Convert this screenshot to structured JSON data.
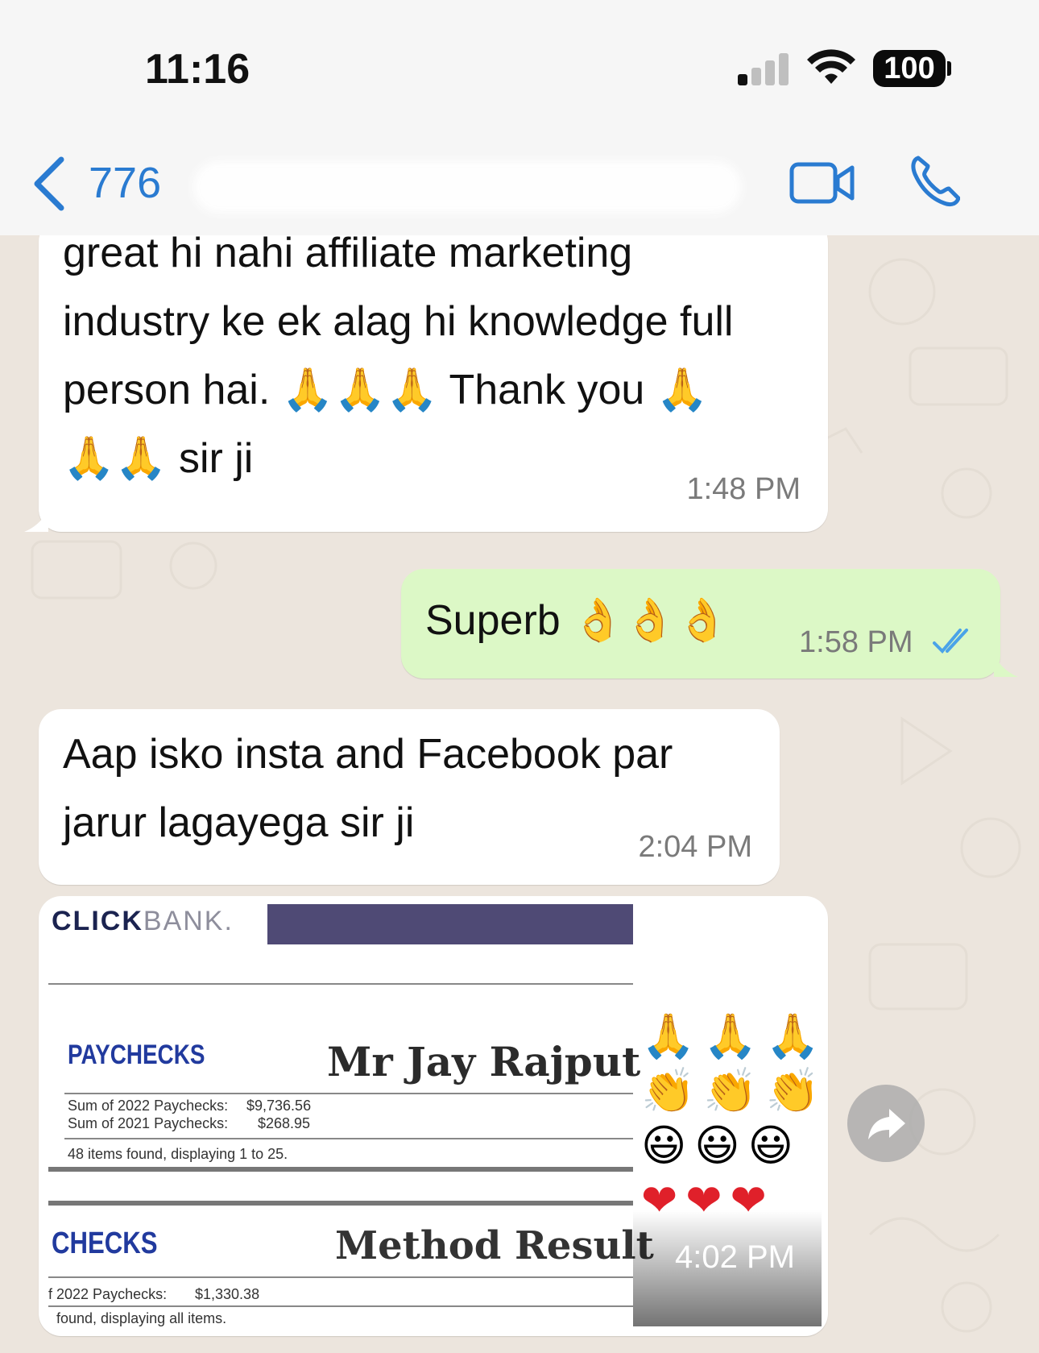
{
  "status_bar": {
    "time": "11:16",
    "battery": "100"
  },
  "header": {
    "back_label": "776"
  },
  "messages": [
    {
      "direction": "in",
      "lines": [
        "great hi nahi affiliate marketing",
        "industry ke ek alag hi knowledge full",
        "person hai. 🙏🙏🙏 Thank you 🙏",
        "🙏🙏 sir ji"
      ],
      "time": "1:48 PM"
    },
    {
      "direction": "out",
      "text": "Superb 👌👌👌",
      "time": "1:58 PM",
      "status": "read"
    },
    {
      "direction": "in",
      "lines": [
        "Aap isko insta and Facebook par",
        "jarur lagayega sir ji"
      ],
      "time": "2:04 PM"
    },
    {
      "direction": "in",
      "type": "image",
      "time": "4:02 PM",
      "image": {
        "logo_part1": "CLICK",
        "logo_part2": "BANK.",
        "paychecks_title": "PAYCHECKS",
        "name": "Mr Jay Rajput",
        "sum_2022_label": "Sum of 2022 Paychecks:",
        "sum_2022_value": "$9,736.56",
        "sum_2021_label": "Sum of 2021 Paychecks:",
        "sum_2021_value": "$268.95",
        "items_found": "48 items found, displaying 1 to 25.",
        "checks_title": "CHECKS",
        "method_result": "Method Result",
        "sum2_label": "f 2022 Paychecks:",
        "sum2_value": "$1,330.38",
        "found_all": "found, displaying all items.",
        "emoji_rows": [
          "🙏🙏🙏",
          "👏👏👏",
          "😃😃😃",
          "❤❤❤"
        ]
      }
    }
  ],
  "colors": {
    "accent": "#2a7bd1",
    "outgoing_bubble": "#dcf8c6",
    "incoming_bubble": "#ffffff",
    "chat_background": "#ece5dd",
    "read_ticks": "#4aa3e8"
  },
  "icons": [
    "back-chevron-icon",
    "video-call-icon",
    "phone-call-icon",
    "read-ticks-icon",
    "forward-icon",
    "signal-icon",
    "wifi-icon",
    "battery-icon"
  ]
}
